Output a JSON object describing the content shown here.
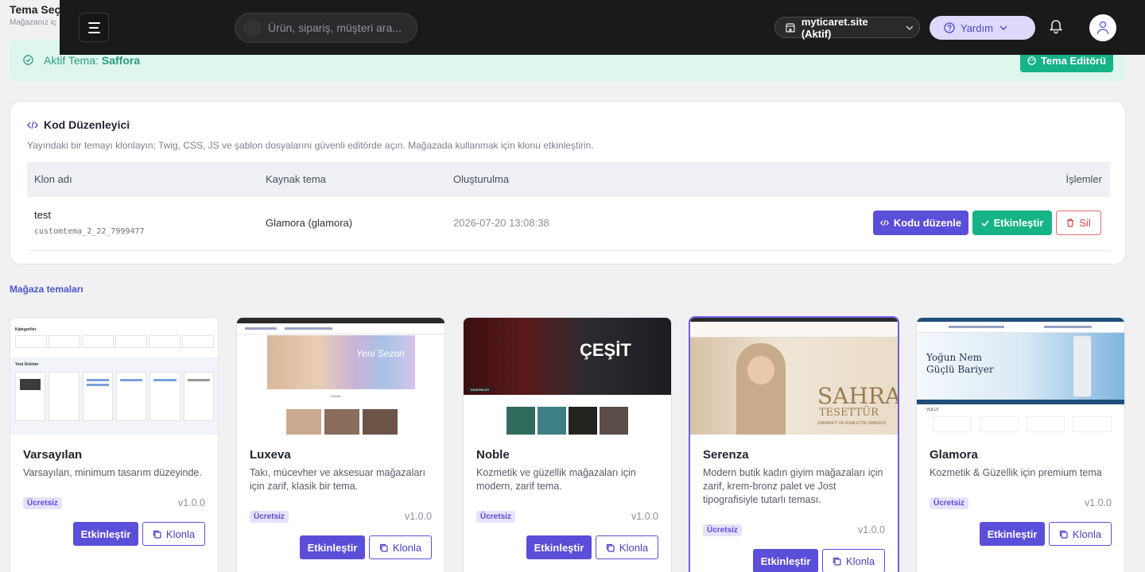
{
  "page": {
    "title": "Tema Seç",
    "subtitle": "Mağazanız iç"
  },
  "topbar": {
    "search_placeholder": "Ürün, sipariş, müşteri ara...",
    "store": "myticaret.site (Aktif)",
    "help": "Yardım"
  },
  "active_theme": {
    "label": "Aktif Tema:",
    "name": "Saffora",
    "editor_button": "Tema Editörü"
  },
  "code_editor": {
    "title": "Kod Düzenleyici",
    "description": "Yayındaki bir temayı klonlayın; Twig, CSS, JS ve şablon dosyalarını güvenli editörde açın. Mağazada kullanmak için klonu etkinleştirin.",
    "columns": [
      "Klon adı",
      "Kaynak tema",
      "Oluşturulma",
      "İşlemler"
    ],
    "rows": [
      {
        "name": "test",
        "code": "customtema_2_22_7999477",
        "source": "Glamora (glamora)",
        "created": "2026-07-20 13:08:38",
        "edit": "Kodu düzenle",
        "activate": "Etkinleştir",
        "delete": "Sil"
      }
    ]
  },
  "store_themes": {
    "section_title": "Mağaza temaları",
    "apply_label": "Etkinleştir",
    "clone_label": "Klonla",
    "items": [
      {
        "name": "Varsayılan",
        "description": "Varsayılan, minimum tasarım düzeyinde.",
        "badge": "Ücretsiz",
        "version": "v1.0.0"
      },
      {
        "name": "Luxeva",
        "description": "Takı, mücevher ve aksesuar mağazaları için zarif, klasik bir tema.",
        "badge": "Ücretsiz",
        "version": "v1.0.0"
      },
      {
        "name": "Noble",
        "description": "Kozmetik ve güzellik mağazaları için modern, zarif tema.",
        "badge": "Ücretsiz",
        "version": "v1.0.0"
      },
      {
        "name": "Serenza",
        "description": "Modern butik kadın giyim mağazaları için zarif, krem-bronz palet ve Jost tipografisiyle tutarlı teması.",
        "badge": "Ücretsiz",
        "version": "v1.0.0"
      },
      {
        "name": "Glamora",
        "description": "Kozmetik & Güzellik için premium tema",
        "badge": "Ücretsiz",
        "version": "v1.0.0"
      }
    ]
  },
  "thumbnails": {
    "varsayilan": {
      "categories": "Kategoriler",
      "new_products": "Yeni Ürünler"
    },
    "luxeva": {
      "banner_text": "Yeni Sezon",
      "section": "Ürünler"
    },
    "noble": {
      "banner_word": "ÇEŞİT",
      "tag": "İNDİRİMLER"
    },
    "serenza": {
      "brand": "SAHRA",
      "brand_sub": "TESETTÜR",
      "tagline": "ZARAFET VE ASALETİN SİMGESİ"
    },
    "glamora": {
      "headline1": "Yoğun Nem",
      "headline2": "Güçlü Bariyer",
      "brand": "VULLY"
    }
  },
  "colors": {
    "primary": "#5b4ed8",
    "success": "#15b385",
    "danger": "#d64545",
    "topbar": "#1a1a1a"
  }
}
